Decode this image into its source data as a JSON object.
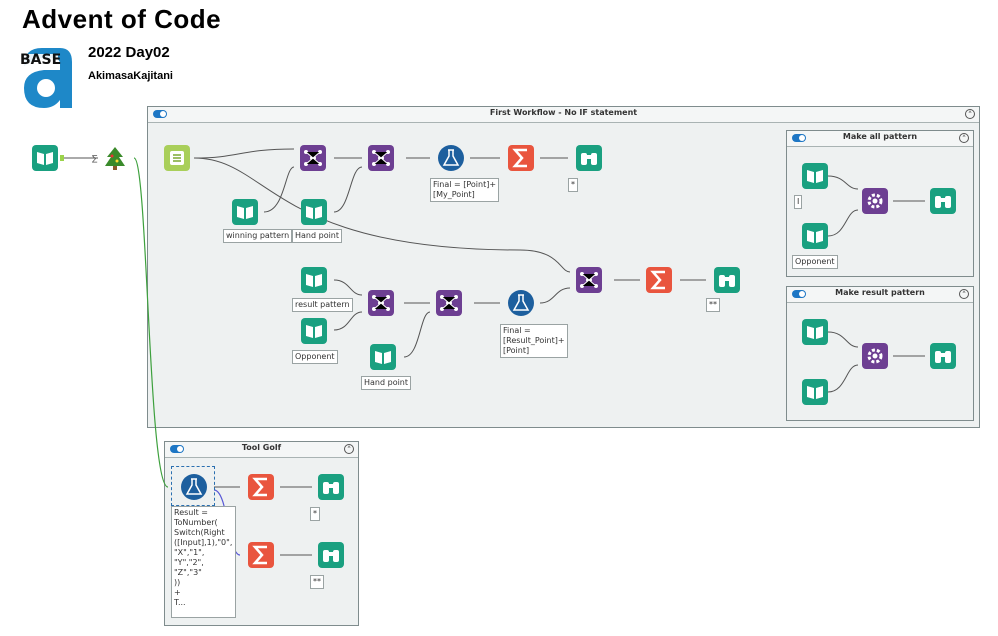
{
  "header": {
    "title": "Advent of Code",
    "logo_text": "BASE",
    "year_day": "2022   Day02",
    "author": "AkimasaKajitani"
  },
  "containers": {
    "first": {
      "title": "First Workflow - No IF statement",
      "collapse": "^"
    },
    "make_all": {
      "title": "Make all pattern",
      "collapse": "^"
    },
    "make_result": {
      "title": "Make result pattern",
      "collapse": "^"
    },
    "golf": {
      "title": "Tool Golf",
      "collapse": "^"
    }
  },
  "annotations": {
    "winning_pattern": "winning pattern",
    "hand_point_1": "Hand point",
    "formula_1": "Final = [Point]+\n[My_Point]",
    "browse_1": "*",
    "result_pattern": "result pattern",
    "opponent_1": "Opponent",
    "hand_point_2": "Hand point",
    "formula_2": "Final =\n[Result_Point]+\n[Point]",
    "browse_2": "**",
    "make_all_i": "I",
    "opponent_2": "Opponent",
    "golf_formula": "Result =\nToNumber(\nSwitch(Right\n([Input],1),\"0\",\n\"X\",\"1\",\n\"Y\",\"2\",\n\"Z\",\"3\"\n))\n+\nT...",
    "golf_browse_1": "*",
    "golf_browse_2": "**"
  },
  "icons": {
    "input": "book-icon",
    "sample": "tree-icon",
    "text_to_columns": "split-icon",
    "join": "join-icon",
    "formula": "flask-icon",
    "summarize": "sigma-icon",
    "browse": "binoculars-icon",
    "append": "gear-icon"
  },
  "colors": {
    "input": "#1aa080",
    "join": "#6d3f92",
    "formula": "#1d5f9e",
    "summarize": "#e9553e",
    "browse": "#1aa080",
    "tree": "#3a8a2a",
    "logo": "#1e88c8",
    "wire": "#555555",
    "wire_green": "#3da03d",
    "wire_blue": "#5858d6"
  }
}
